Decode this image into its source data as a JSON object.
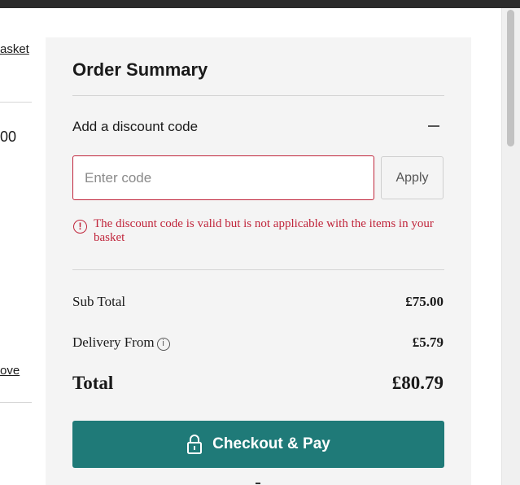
{
  "left_column": {
    "basket_link": "asket",
    "price_fragment": "00",
    "remove_link": "ove"
  },
  "summary": {
    "title": "Order Summary",
    "discount_label": "Add a discount code",
    "collapse_icon": "minus-icon",
    "code_input": {
      "value": "",
      "placeholder": "Enter code"
    },
    "apply_label": "Apply",
    "error_message": "The discount code is valid but is not applicable with the items in your basket",
    "error_color": "#c0253b",
    "rows": {
      "subtotal_label": "Sub Total",
      "subtotal_value": "£75.00",
      "delivery_label": "Delivery From",
      "delivery_value": "£5.79",
      "total_label": "Total",
      "total_value": "£80.79"
    },
    "checkout_label": "Checkout & Pay",
    "checkout_color": "#1f7a78"
  }
}
